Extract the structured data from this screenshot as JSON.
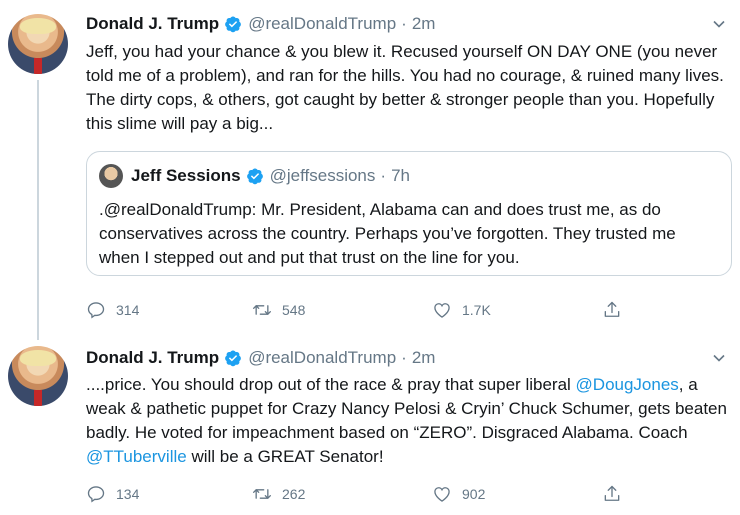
{
  "tweets": [
    {
      "author": "Donald J. Trump",
      "handle": "@realDonaldTrump",
      "time": "2m",
      "text": "Jeff, you had your chance & you blew it. Recused yourself ON DAY ONE (you never told me of a problem), and ran for the hills. You had no courage, & ruined many lives. The dirty cops, & others, got caught by better & stronger people than you. Hopefully this slime will pay a big...",
      "quoted": {
        "author": "Jeff Sessions",
        "handle": "@jeffsessions",
        "time": "7h",
        "text": ".@realDonaldTrump: Mr. President, Alabama can and does trust me, as do conservatives across the country. Perhaps you’ve forgotten. They trusted me when I stepped out and put that trust on the line for you."
      },
      "replies": "314",
      "retweets": "548",
      "likes": "1.7K"
    },
    {
      "author": "Donald J. Trump",
      "handle": "@realDonaldTrump",
      "time": "2m",
      "text_parts": {
        "p1": "....price. You should drop out of the race & pray that super liberal ",
        "link1": "@DougJones",
        "p2": ", a weak & pathetic puppet for Crazy Nancy Pelosi & Cryin’ Chuck Schumer, gets beaten badly. He voted for impeachment based on “ZERO”. Disgraced Alabama. Coach ",
        "link2": "@TTuberville",
        "p3": " will be a GREAT Senator!"
      },
      "replies": "134",
      "retweets": "262",
      "likes": "902"
    }
  ],
  "separator": "·",
  "icons": [
    "verified-badge-icon",
    "chevron-down-icon",
    "reply-icon",
    "retweet-icon",
    "like-icon",
    "share-icon"
  ],
  "colors": {
    "text": "#14171a",
    "secondary": "#657786",
    "link": "#1b95e0",
    "verified": "#1da1f2",
    "border": "#ccd6dd"
  }
}
